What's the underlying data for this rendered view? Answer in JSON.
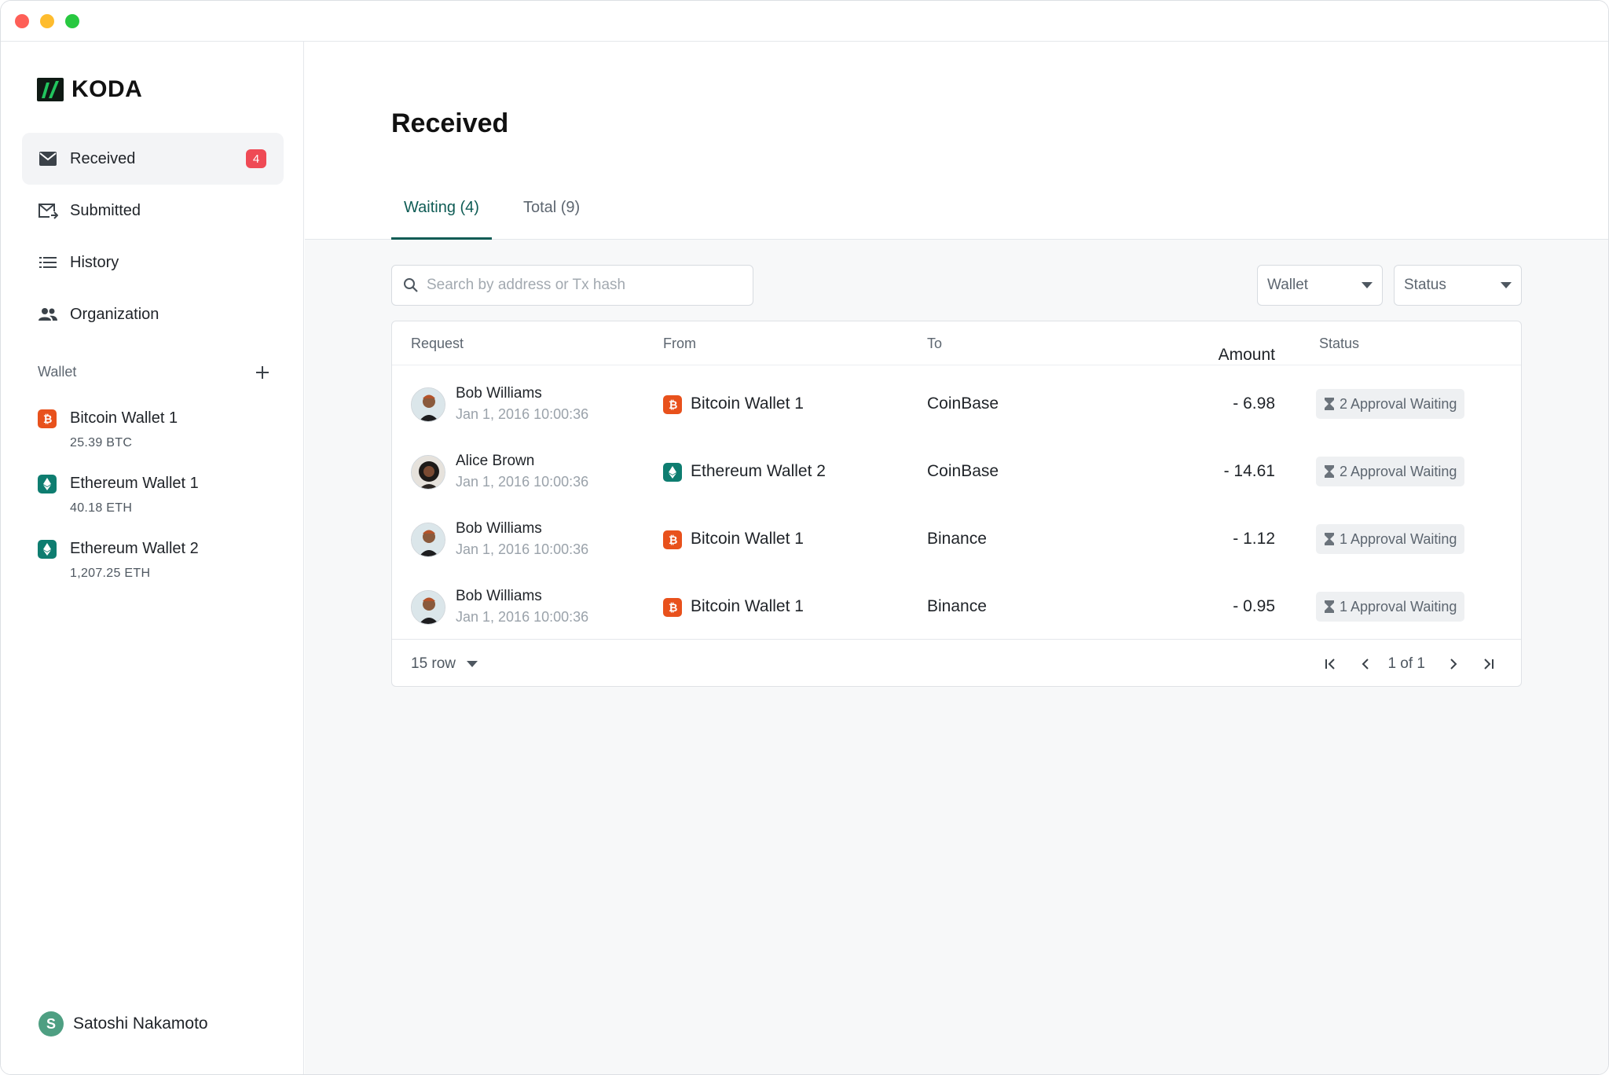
{
  "app": {
    "brand": "KODA"
  },
  "sidebar": {
    "nav": [
      {
        "label": "Received",
        "icon": "mail-icon",
        "badge": "4",
        "active": true
      },
      {
        "label": "Submitted",
        "icon": "mail-send-icon"
      },
      {
        "label": "History",
        "icon": "list-icon"
      },
      {
        "label": "Organization",
        "icon": "people-icon"
      }
    ],
    "wallet_section_label": "Wallet",
    "wallets": [
      {
        "name": "Bitcoin Wallet 1",
        "amount": "25.39 BTC",
        "icon": "bitcoin-icon"
      },
      {
        "name": "Ethereum Wallet 1",
        "amount": "40.18 ETH",
        "icon": "ethereum-icon"
      },
      {
        "name": "Ethereum Wallet 2",
        "amount": "1,207.25 ETH",
        "icon": "ethereum-icon"
      }
    ],
    "user": {
      "initial": "S",
      "name": "Satoshi Nakamoto"
    }
  },
  "main": {
    "title": "Received",
    "tabs": [
      {
        "label": "Waiting (4)",
        "active": true
      },
      {
        "label": "Total (9)"
      }
    ],
    "search": {
      "placeholder": "Search by address or Tx hash",
      "value": ""
    },
    "filters": {
      "wallet": "Wallet",
      "status": "Status"
    },
    "table": {
      "columns": [
        "Request",
        "From",
        "To",
        "Amount",
        "Status"
      ],
      "rows": [
        {
          "name": "Bob Williams",
          "date": "Jan 1, 2016 10:00:36",
          "from": "Bitcoin Wallet 1",
          "from_type": "btc",
          "to": "CoinBase",
          "amount": "- 6.98",
          "status": "2 Approval Waiting"
        },
        {
          "name": "Alice Brown",
          "date": "Jan 1, 2016 10:00:36",
          "from": "Ethereum Wallet 2",
          "from_type": "eth",
          "to": "CoinBase",
          "amount": "- 14.61",
          "status": "2 Approval Waiting"
        },
        {
          "name": "Bob Williams",
          "date": "Jan 1, 2016 10:00:36",
          "from": "Bitcoin Wallet 1",
          "from_type": "btc",
          "to": "Binance",
          "amount": "- 1.12",
          "status": "1 Approval Waiting"
        },
        {
          "name": "Bob Williams",
          "date": "Jan 1, 2016 10:00:36",
          "from": "Bitcoin Wallet 1",
          "from_type": "btc",
          "to": "Binance",
          "amount": "- 0.95",
          "status": "1 Approval Waiting"
        }
      ]
    },
    "pagination": {
      "rows_per_page": "15 row",
      "page_text": "1 of 1"
    }
  },
  "colors": {
    "accent": "#0f5c55",
    "badge": "#ef4a55",
    "bitcoin": "#e8511c",
    "ethereum": "#0e7d70",
    "logo_green": "#22c55e"
  }
}
